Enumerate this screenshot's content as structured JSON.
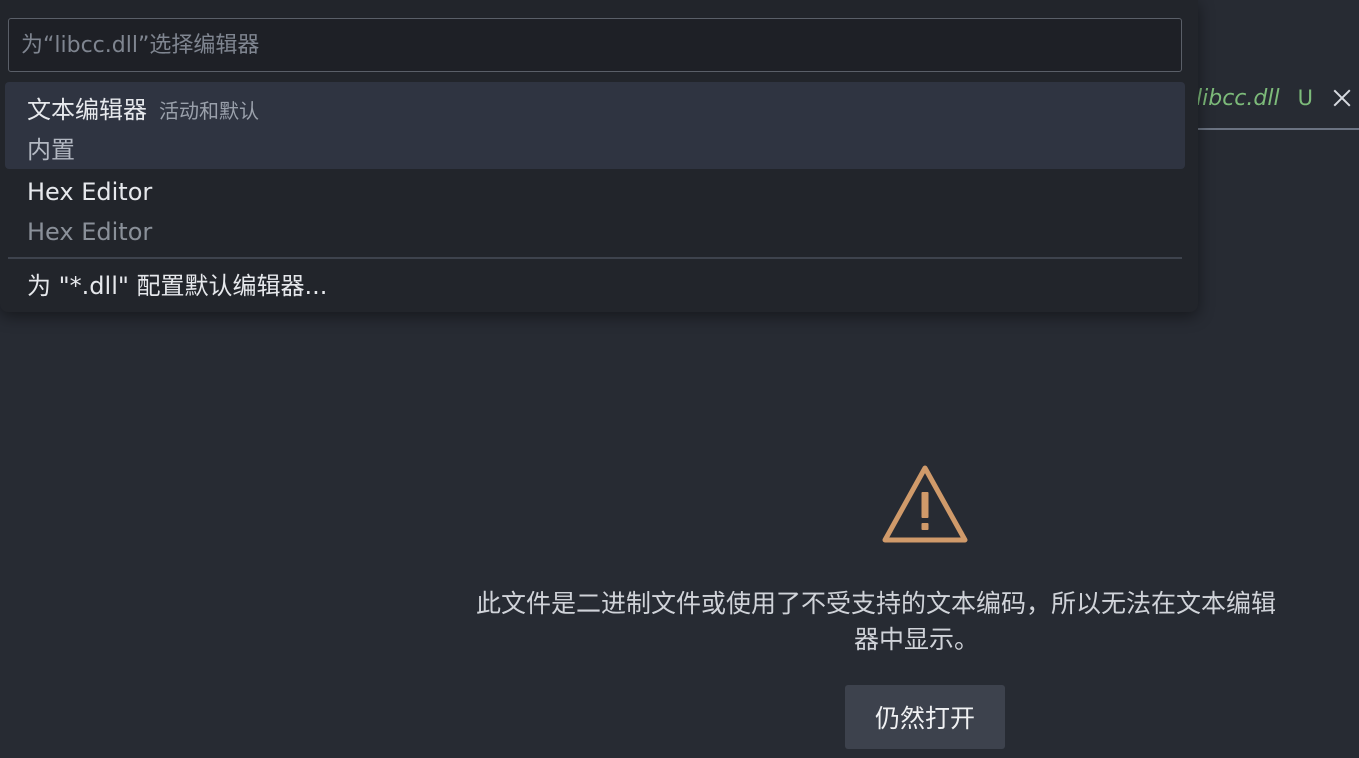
{
  "tab": {
    "title": "libcc.dll",
    "status_badge": "U",
    "close_icon": "close-icon",
    "title_color": "#7dbb7a"
  },
  "quick_pick": {
    "placeholder": "为“libcc.dll”选择编辑器",
    "items": [
      {
        "label": "文本编辑器",
        "description": "活动和默认",
        "detail": "内置",
        "selected": true
      },
      {
        "label": "Hex Editor",
        "description": "",
        "detail": "Hex Editor",
        "selected": false
      },
      {
        "label": "为 \"*.dll\" 配置默认编辑器...",
        "description": "",
        "detail": "",
        "selected": false
      }
    ]
  },
  "binary_warning": {
    "icon": "warning-icon",
    "icon_color": "#d09a6a",
    "message_line1": "此文件是二进制文件或使用了不受支持的文本编码，所以无法在文本编辑",
    "message_line2": "器中显示。",
    "open_anyway_label": "仍然打开"
  }
}
